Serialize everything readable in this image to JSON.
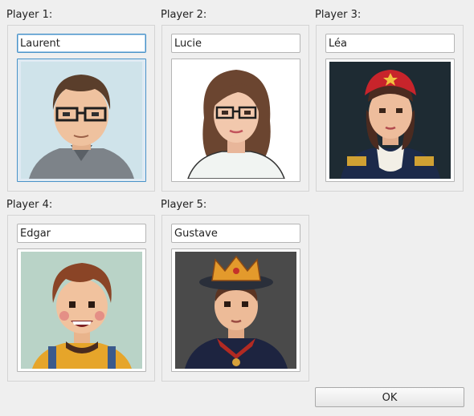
{
  "players": [
    {
      "label": "Player 1:",
      "name": "Laurent",
      "avatar": "avatar-man-glasses-icon",
      "bg": "#cfe3ea"
    },
    {
      "label": "Player 2:",
      "name": "Lucie",
      "avatar": "avatar-woman-glasses-icon",
      "bg": "#ffffff"
    },
    {
      "label": "Player 3:",
      "name": "Léa",
      "avatar": "avatar-woman-red-cap-icon",
      "bg": "#1e2b33"
    },
    {
      "label": "Player 4:",
      "name": "Edgar",
      "avatar": "avatar-smiling-boy-icon",
      "bg": "#b9d3c7"
    },
    {
      "label": "Player 5:",
      "name": "Gustave",
      "avatar": "avatar-crowned-boy-icon",
      "bg": "#4a4a4a"
    }
  ],
  "ok_label": "OK"
}
